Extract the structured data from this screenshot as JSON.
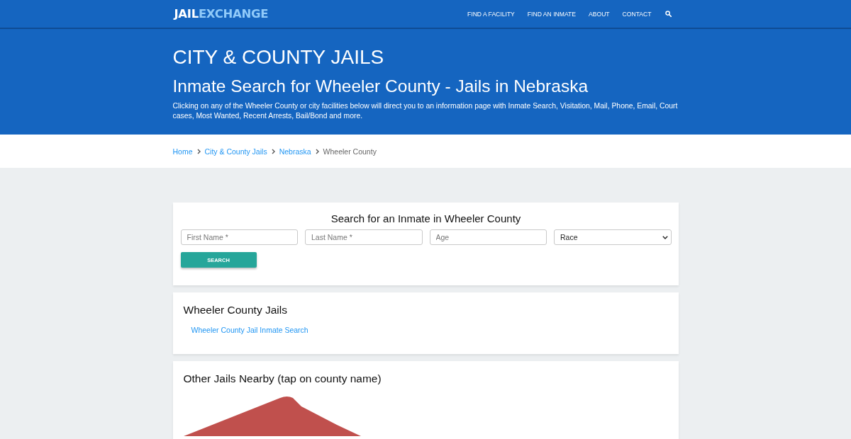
{
  "navbar": {
    "logo": {
      "first": "JAIL",
      "second": "EXCHANGE"
    },
    "links": [
      "FIND A FACILITY",
      "FIND AN INMATE",
      "ABOUT",
      "CONTACT"
    ]
  },
  "header": {
    "category": "CITY & COUNTY JAILS",
    "title": "Inmate Search for Wheeler County - Jails in Nebraska",
    "description": "Clicking on any of the Wheeler County or city facilities below will direct you to an information page with Inmate Search, Visitation, Mail, Phone, Email, Court cases, Most Wanted, Recent Arrests, Bail/Bond and more."
  },
  "breadcrumb": [
    {
      "label": "Home",
      "kind": "link"
    },
    {
      "label": "City & County Jails",
      "kind": "link"
    },
    {
      "label": "Nebraska",
      "kind": "link"
    },
    {
      "label": "Wheeler County",
      "kind": "current"
    }
  ],
  "search_card": {
    "title": "Search for an Inmate in Wheeler County",
    "fields": [
      {
        "kind": "text",
        "placeholder": "First Name *"
      },
      {
        "kind": "text",
        "placeholder": "Last Name *"
      },
      {
        "kind": "text",
        "placeholder": "Age"
      },
      {
        "kind": "select",
        "value": "Race"
      }
    ],
    "button": "SEARCH"
  },
  "county_jails": {
    "title": "Wheeler County Jails",
    "links": [
      "Wheeler County Jail Inmate Search"
    ]
  },
  "nearby": {
    "title": "Other Jails Nearby (tap on county name)"
  }
}
